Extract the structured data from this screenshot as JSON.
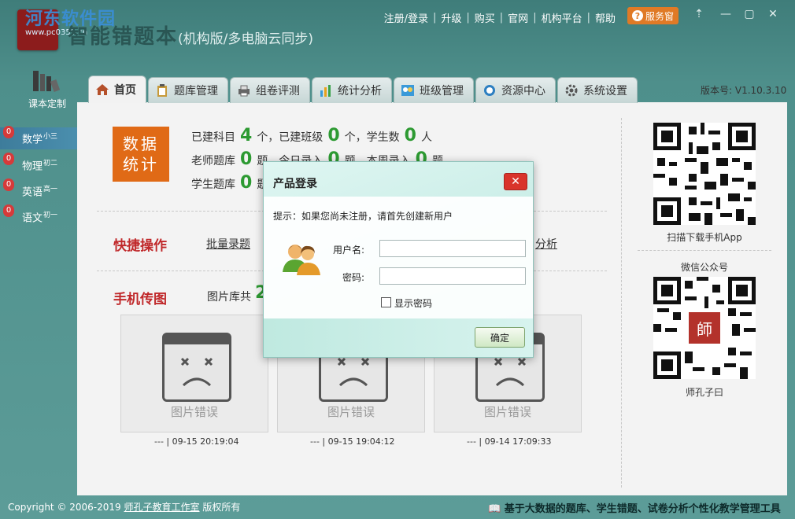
{
  "header": {
    "watermark": "河东软件园",
    "watermark_url": "www.pc0359.cn",
    "title_main": "智能错题本",
    "title_sub": "(机构版/多电脑云同步)",
    "nav": [
      "注册/登录",
      "升级",
      "购买",
      "官网",
      "机构平台",
      "帮助"
    ],
    "service_label": "服务窗",
    "win_controls": [
      "⇡",
      "—",
      "▢",
      "✕"
    ]
  },
  "left": {
    "book_label": "课本定制",
    "subjects": [
      {
        "name": "数学",
        "grade": "小三",
        "count": "0",
        "active": true
      },
      {
        "name": "物理",
        "grade": "初二",
        "count": "0",
        "active": false
      },
      {
        "name": "英语",
        "grade": "高一",
        "count": "0",
        "active": false
      },
      {
        "name": "语文",
        "grade": "初一",
        "count": "0",
        "active": false
      }
    ]
  },
  "tabs": [
    {
      "label": "首页",
      "icon": "home-icon"
    },
    {
      "label": "题库管理",
      "icon": "clipboard-icon"
    },
    {
      "label": "组卷评测",
      "icon": "printer-icon"
    },
    {
      "label": "统计分析",
      "icon": "bar-chart-icon"
    },
    {
      "label": "班级管理",
      "icon": "class-icon"
    },
    {
      "label": "资源中心",
      "icon": "cloud-icon"
    },
    {
      "label": "系统设置",
      "icon": "gear-icon"
    }
  ],
  "version": "版本号: V1.10.3.10",
  "stats": {
    "block_line1": "数据",
    "block_line2": "统计",
    "row1": {
      "a": "已建科目",
      "a_val": "4",
      "b": "个，已建班级",
      "b_val": "0",
      "c": "个，学生数",
      "c_val": "0",
      "d": "人"
    },
    "row2": {
      "a": "老师题库",
      "a_val": "0",
      "b": "题，今日录入",
      "b_val": "0",
      "c": "题，本周录入",
      "c_val": "0",
      "d": "题"
    },
    "row3": {
      "a": "学生题库",
      "a_val": "0",
      "b": "题"
    }
  },
  "quick": {
    "title": "快捷操作",
    "link1": "批量录题",
    "link_right": "分析"
  },
  "mobile": {
    "title": "手机传图",
    "lib_label": "图片库共",
    "lib_count": "2",
    "cards": [
      {
        "err": "图片错误",
        "ts": "--- | 09-15 20:19:04"
      },
      {
        "err": "图片错误",
        "ts": "--- | 09-15 19:04:12"
      },
      {
        "err": "图片错误",
        "ts": "--- | 09-14 17:09:33"
      }
    ]
  },
  "qr": {
    "app_caption": "扫描下载手机App",
    "wechat_title": "微信公众号",
    "wechat_caption": "师孔子曰",
    "seal_text": "師"
  },
  "footer": {
    "copyright_prefix": "Copyright © 2006-2019",
    "company": "师孔子教育工作室",
    "copyright_suffix": "版权所有",
    "slogan": "基于大数据的题库、学生错题、试卷分析个性化教学管理工具"
  },
  "modal": {
    "title": "产品登录",
    "close": "✕",
    "hint": "提示：如果您尚未注册，请首先创建新用户",
    "username_label": "用户名:",
    "username_value": "",
    "password_label": "密码:",
    "password_value": "",
    "show_password_label": "显示密码",
    "ok_label": "确定"
  },
  "colors": {
    "accent_orange": "#e06a16",
    "stat_green": "#2d9a32",
    "section_red": "#c0282a",
    "badge_red": "#d63a3a"
  }
}
